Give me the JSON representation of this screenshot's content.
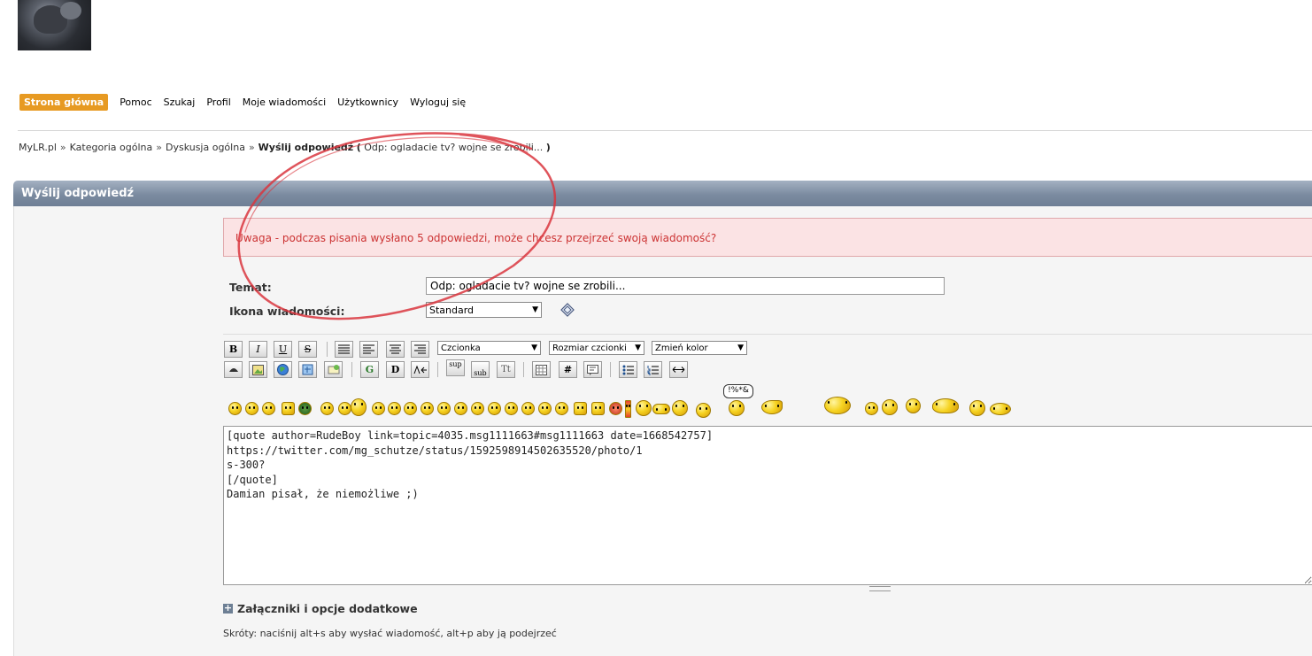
{
  "nav": {
    "items": [
      "Strona główna",
      "Pomoc",
      "Szukaj",
      "Profil",
      "Moje wiadomości",
      "Użytkownicy",
      "Wyloguj się"
    ],
    "active_color": "#e79a22"
  },
  "breadcrumb": {
    "site": "MyLR.pl",
    "category": "Kategoria ogólna",
    "board": "Dyskusja ogólna",
    "current": "Wyślij odpowiedź",
    "open": "(",
    "topic": "Odp: ogladacie tv? wojne se zrobili...",
    "close": ")",
    "separator": "»"
  },
  "panel": {
    "title": "Wyślij odpowiedź"
  },
  "warning": {
    "text": "Uwaga - podczas pisania wysłano 5 odpowiedzi, może chcesz przejrzeć swoją wiadomość?"
  },
  "form": {
    "subject_label": "Temat:",
    "subject_value": "Odp: ogladacie tv? wojne se zrobili...",
    "icon_label": "Ikona wiadomości:",
    "icon_value": "Standard"
  },
  "toolbar": {
    "bold": "B",
    "italic": "I",
    "underline": "U",
    "strike": "S",
    "font": "Czcionka",
    "size": "Rozmiar czcionki",
    "color": "Zmień kolor",
    "glow": "G",
    "shadow": "D",
    "sup": "sup",
    "sub": "sub",
    "tt": "Tt",
    "code": "#"
  },
  "editor": {
    "text": "[quote author=RudeBoy link=topic=4035.msg1111663#msg1111663 date=1668542757]\nhttps://twitter.com/mg_schutze/status/1592598914502635520/photo/1\ns-300?\n[/quote]\nDamian pisał, że niemożliwe ;)"
  },
  "smiley_bubble": "!%*&",
  "attachments": {
    "label": "Załączniki i opcje dodatkowe",
    "icon": "plus-icon"
  },
  "shortcuts": {
    "text": "Skróty: naciśnij alt+s aby wysłać wiadomość, alt+p aby ją podejrzeć"
  },
  "annotation": {
    "color": "#d9363e"
  }
}
